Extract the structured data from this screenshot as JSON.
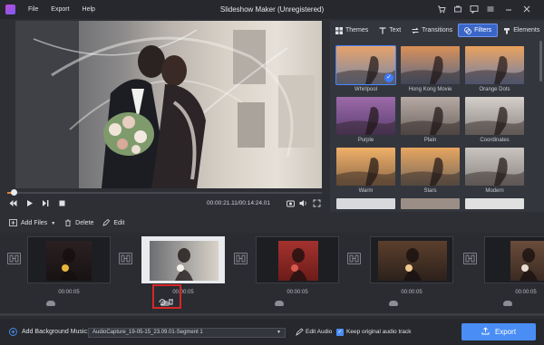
{
  "app": {
    "title": "Slideshow Maker (Unregistered)"
  },
  "menu": {
    "file": "File",
    "export": "Export",
    "help": "Help"
  },
  "player": {
    "time_current": "00:00:21.11",
    "time_total": "00:14:24.01",
    "progress": 0.02
  },
  "panel": {
    "tabs": [
      {
        "label": "Themes",
        "active": false
      },
      {
        "label": "Text",
        "active": false
      },
      {
        "label": "Transitions",
        "active": false
      },
      {
        "label": "Filters",
        "active": true
      },
      {
        "label": "Elements",
        "active": false
      }
    ],
    "filters": [
      {
        "name": "Whirlpool",
        "selected": true
      },
      {
        "name": "Hong Kong Movie",
        "selected": false
      },
      {
        "name": "Orange Dots",
        "selected": false
      },
      {
        "name": "Purple",
        "selected": false
      },
      {
        "name": "Plain",
        "selected": false
      },
      {
        "name": "Coordinates",
        "selected": false
      },
      {
        "name": "Warm",
        "selected": false
      },
      {
        "name": "Stars",
        "selected": false
      },
      {
        "name": "Modern",
        "selected": false
      }
    ]
  },
  "toolbar": {
    "add_files": "Add Files",
    "delete": "Delete",
    "edit": "Edit"
  },
  "timeline": {
    "clips": [
      {
        "duration": "00:00:05"
      },
      {
        "duration": "00:00:05"
      },
      {
        "duration": "00:00:05"
      },
      {
        "duration": "00:00:05"
      },
      {
        "duration": "00:00:05"
      }
    ]
  },
  "bottom": {
    "bg_music_label": "Add Background Music:",
    "music_value": "AudioCapture_19-05-15_23.09.01-Segment 1",
    "edit_audio": "Edit Audio",
    "keep_audio": "Keep original audio track",
    "export": "Export"
  },
  "colors": {
    "accent": "#4a8ef5",
    "progress": "#e0822e",
    "highlight": "#d72727"
  }
}
